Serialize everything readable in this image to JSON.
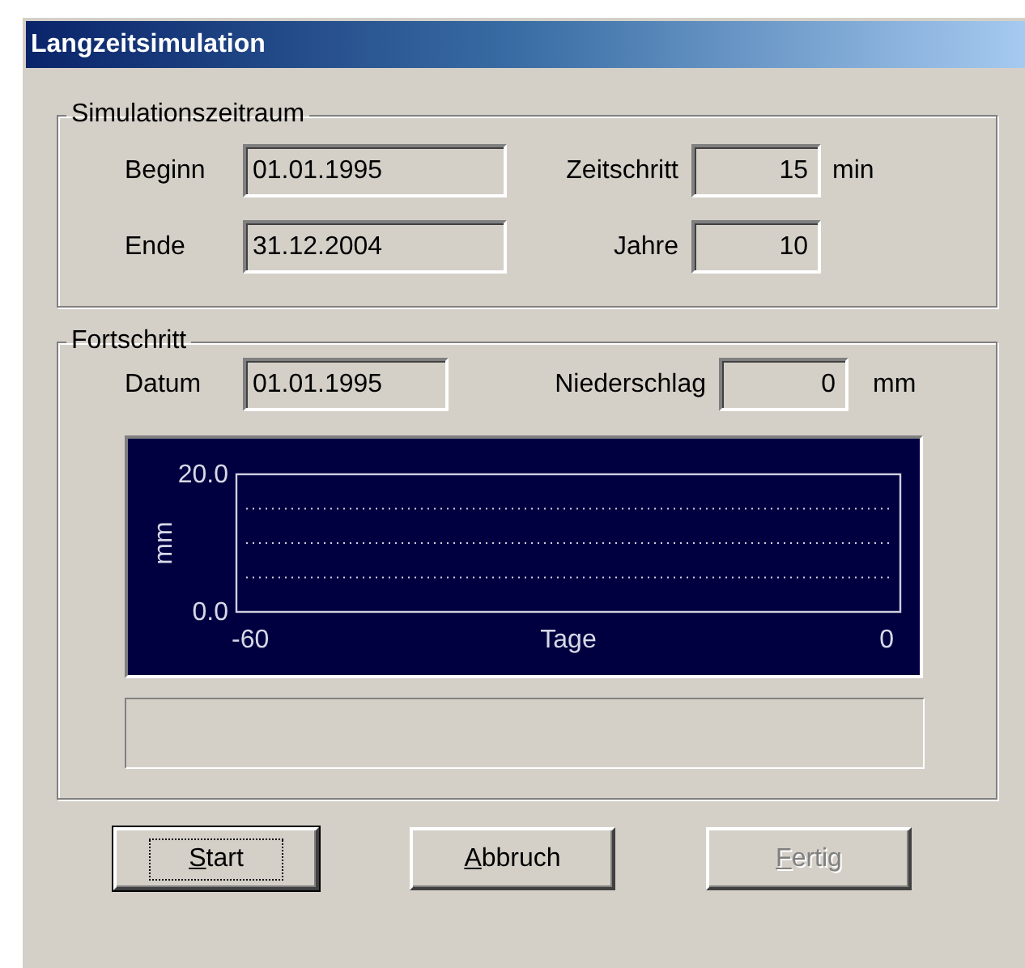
{
  "window": {
    "title": "Langzeitsimulation"
  },
  "period": {
    "title": "Simulationszeitraum",
    "fields": [
      {
        "label": "Beginn",
        "value": "01.01.1995",
        "kind": "date"
      },
      {
        "label": "Zeitschritt",
        "value": "15",
        "kind": "number",
        "unit": "min"
      },
      {
        "label": "Ende",
        "value": "31.12.2004",
        "kind": "date"
      },
      {
        "label": "Jahre",
        "value": "10",
        "kind": "number"
      }
    ]
  },
  "progress": {
    "title": "Fortschritt",
    "fields": [
      {
        "label": "Datum",
        "value": "01.01.1995",
        "kind": "date"
      },
      {
        "label": "Niederschlag",
        "value": "0",
        "kind": "number",
        "unit": "mm"
      }
    ],
    "chart_data": {
      "type": "bar",
      "xlabel": "Tage",
      "ylabel": "mm",
      "xlim": [
        -60,
        0
      ],
      "ylim": [
        0,
        20
      ],
      "xticks": [
        -60,
        0
      ],
      "yticks": [
        {
          "value": 0,
          "label": "0.0"
        },
        {
          "value": 20,
          "label": "20.0"
        }
      ]
    },
    "bar": {
      "level": 0
    }
  },
  "buttons": [
    {
      "label": "Start",
      "focused": true,
      "disabled": false
    },
    {
      "label": "Abbruch",
      "focused": false,
      "disabled": false
    },
    {
      "label": "Fertig",
      "focused": false,
      "disabled": true
    }
  ]
}
